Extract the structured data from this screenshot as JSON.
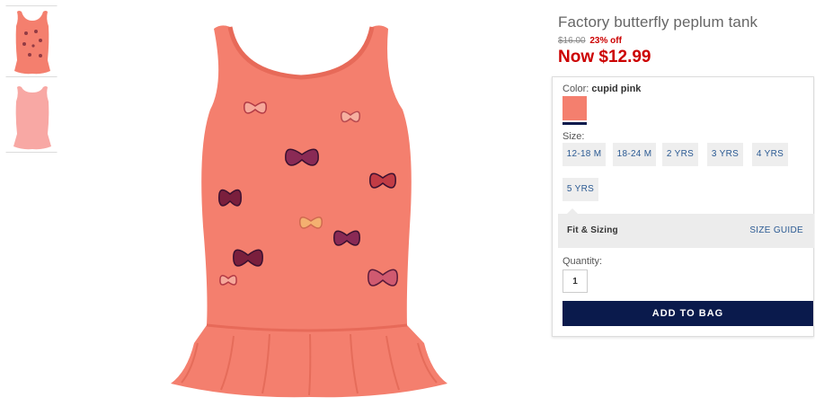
{
  "product": {
    "title": "Factory butterfly peplum tank",
    "original_price": "$16.00",
    "discount": "23% off",
    "now_price": "Now $12.99"
  },
  "images": {
    "thumbnails": [
      {
        "name": "front view with butterflies",
        "color": "#f47f6e"
      },
      {
        "name": "back view",
        "color": "#f8a8a4"
      }
    ],
    "main_color": "#f47f6e"
  },
  "color": {
    "label": "Color:",
    "selected": "cupid pink",
    "swatch_color": "#f47f6e"
  },
  "sizes": {
    "label": "Size:",
    "options": [
      "12-18 M",
      "18-24 M",
      "2 YRS",
      "3 YRS",
      "4 YRS",
      "5 YRS"
    ]
  },
  "fit": {
    "title": "Fit & Sizing",
    "size_guide": "SIZE GUIDE"
  },
  "quantity": {
    "label": "Quantity:",
    "value": "1"
  },
  "actions": {
    "add_to_bag": "ADD TO BAG"
  },
  "colors": {
    "accent_red": "#cc0000",
    "navy": "#0a1a4c",
    "link_blue": "#2b5a93"
  }
}
